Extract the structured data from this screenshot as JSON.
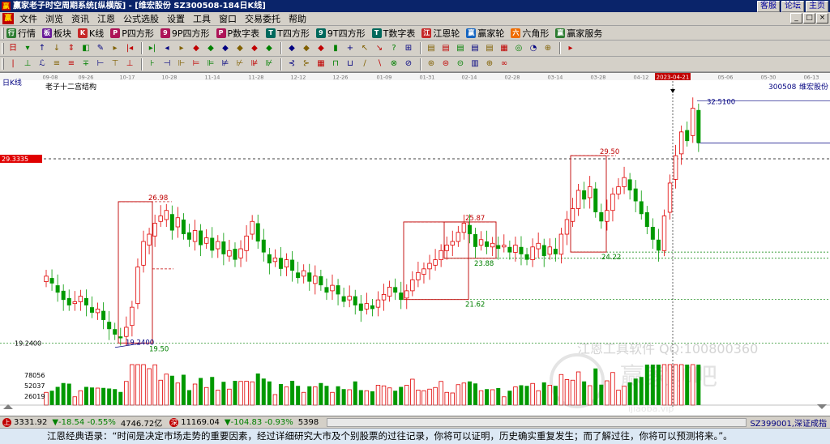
{
  "window": {
    "app_icon": "app-logo-icon",
    "title": "赢家老子时空周期系统[纵横版] - [维宏股份  SZ300508-184日K线]",
    "top_links": [
      "客服",
      "论坛",
      "主页"
    ]
  },
  "menu": {
    "logo": "app-logo-icon",
    "items": [
      "文件",
      "浏览",
      "资讯",
      "江恩",
      "公式选股",
      "设置",
      "工具",
      "窗口",
      "交易委托",
      "帮助"
    ],
    "window_controls": [
      "_",
      "□",
      "×"
    ]
  },
  "toolbar1": {
    "buttons": [
      {
        "label": "行情",
        "icon": "quote-grid-icon",
        "color": "#2e7d32"
      },
      {
        "label": "板块",
        "icon": "sector-icon",
        "color": "#6a1b9a"
      },
      {
        "label": "K线",
        "icon": "kline-icon",
        "color": "#c62828"
      },
      {
        "label": "P四方形",
        "icon": "p-square-icon",
        "color": "#ad1457"
      },
      {
        "label": "9P四方形",
        "icon": "9p-square-icon",
        "color": "#ad1457"
      },
      {
        "label": "P数字表",
        "icon": "p-number-table-icon",
        "color": "#ad1457"
      },
      {
        "label": "T四方形",
        "icon": "t-square-icon",
        "color": "#00695c"
      },
      {
        "label": "9T四方形",
        "icon": "9t-square-icon",
        "color": "#00695c"
      },
      {
        "label": "T数字表",
        "icon": "t-number-table-icon",
        "color": "#00695c"
      },
      {
        "label": "江恩轮",
        "icon": "gann-wheel-icon",
        "color": "#c62828"
      },
      {
        "label": "赢家轮",
        "icon": "winner-wheel-icon",
        "color": "#1565c0"
      },
      {
        "label": "六角形",
        "icon": "hexagon-icon",
        "color": "#ef6c00"
      },
      {
        "label": "赢家服务",
        "icon": "service-icon",
        "color": "#2e7d32"
      }
    ]
  },
  "toolbar2": {
    "icons": [
      "日",
      "▾",
      "↑",
      "↓",
      "⇕",
      "◧",
      "✎",
      "▸",
      "|◂",
      "▸|",
      "◂",
      "▸",
      "◆",
      "◆",
      "◆",
      "◆",
      "◆",
      "◆",
      "◆",
      "◆",
      "◆",
      "▮",
      "+",
      "↖",
      "↘",
      "?",
      "⊞",
      "▤",
      "▤",
      "▤",
      "▤",
      "▤",
      "▦",
      "◎",
      "◔",
      "⊕",
      "▸"
    ]
  },
  "toolbar3": {
    "icons": [
      "|",
      "⊥",
      "ℒ",
      "≡",
      "≡",
      "∓",
      "⊢",
      "⊤",
      "⊥",
      "⊦",
      "⊣",
      "⊩",
      "⊨",
      "⊫",
      "⊭",
      "⊬",
      "⊯",
      "⊮",
      "⊰",
      "⊱",
      "▦",
      "⊓",
      "⊔",
      "∕",
      "∖",
      "⊗",
      "⊘",
      "⊛",
      "⊜",
      "⊝",
      "▥",
      "⊕",
      "∞"
    ]
  },
  "chart_header": {
    "period_label": "日K线",
    "indicator_name": "老子十二宫结构",
    "stock_code": "300508",
    "stock_name": "维宏股份",
    "current_price_tag": "29.3335",
    "high_label": "32.5100",
    "date_highlight": "2023-04-21"
  },
  "chart_data": {
    "type": "candlestick",
    "title": "老子十二宫结构",
    "symbol": "300508 维宏股份",
    "x_ticks": [
      "09-08",
      "09-26",
      "10-17",
      "10-28",
      "11-14",
      "11-28",
      "12-12",
      "12-26",
      "01-09",
      "01-31",
      "02-14",
      "02-28",
      "03-14",
      "03-28",
      "04-12",
      "2023-04-21",
      "05-06",
      "05-30",
      "06-13"
    ],
    "ylim": [
      18.5,
      33.5
    ],
    "price_levels": [
      "26.98",
      "19.2400",
      "19.50",
      "25.87",
      "23.88",
      "21.62",
      "29.50",
      "24.22",
      "32.5100",
      "19.2400"
    ],
    "boxes": [
      {
        "low": 19.24,
        "high": 26.98
      },
      {
        "low": 21.62,
        "high": 25.87
      },
      {
        "low": 23.88,
        "high": 25.87
      },
      {
        "low": 24.22,
        "high": 29.5
      }
    ],
    "watermark": [
      "江恩工具软件 QQ:100800360",
      "赢家聊吧",
      "ijiaoba.vip"
    ],
    "volume_ticks": [
      "78056",
      "52037",
      "26019"
    ],
    "candles_open_close": [
      [
        22.6,
        22.9
      ],
      [
        22.8,
        22.5
      ],
      [
        22.4,
        22.0
      ],
      [
        22.1,
        21.6
      ],
      [
        21.7,
        21.3
      ],
      [
        21.4,
        21.5
      ],
      [
        21.5,
        21.8
      ],
      [
        21.7,
        21.3
      ],
      [
        21.2,
        20.9
      ],
      [
        20.9,
        21.1
      ],
      [
        21.0,
        20.5
      ],
      [
        20.4,
        20.0
      ],
      [
        20.0,
        19.7
      ],
      [
        19.6,
        19.5
      ],
      [
        19.6,
        20.1
      ],
      [
        20.2,
        21.2
      ],
      [
        21.4,
        23.4
      ],
      [
        23.5,
        24.8
      ],
      [
        24.6,
        25.2
      ],
      [
        25.1,
        25.8
      ],
      [
        25.9,
        26.2
      ],
      [
        26.0,
        26.5
      ],
      [
        26.3,
        25.4
      ],
      [
        25.6,
        26.1
      ],
      [
        26.0,
        25.2
      ],
      [
        25.3,
        24.9
      ],
      [
        24.8,
        25.4
      ],
      [
        25.4,
        24.6
      ],
      [
        24.7,
        25.0
      ],
      [
        25.0,
        24.3
      ],
      [
        24.4,
        24.8
      ],
      [
        24.8,
        24.1
      ],
      [
        24.0,
        24.3
      ],
      [
        24.4,
        23.8
      ],
      [
        23.9,
        24.4
      ],
      [
        24.3,
        25.1
      ],
      [
        25.2,
        25.9
      ],
      [
        25.8,
        24.8
      ],
      [
        24.9,
        24.2
      ],
      [
        24.1,
        23.6
      ],
      [
        23.7,
        23.9
      ],
      [
        23.9,
        23.3
      ],
      [
        23.4,
        23.8
      ],
      [
        23.8,
        23.2
      ],
      [
        23.1,
        22.8
      ],
      [
        22.9,
        23.2
      ],
      [
        23.1,
        22.6
      ],
      [
        22.5,
        22.9
      ],
      [
        22.9,
        22.4
      ],
      [
        22.3,
        22.0
      ],
      [
        22.1,
        22.4
      ],
      [
        22.4,
        21.9
      ],
      [
        21.8,
        21.5
      ],
      [
        21.6,
        21.8
      ],
      [
        21.8,
        21.3
      ],
      [
        21.4,
        21.0
      ],
      [
        21.1,
        21.4
      ],
      [
        21.3,
        21.1
      ],
      [
        21.2,
        21.6
      ],
      [
        21.6,
        21.9
      ],
      [
        21.8,
        22.3
      ],
      [
        22.3,
        22.0
      ],
      [
        22.0,
        21.6
      ],
      [
        21.7,
        22.1
      ],
      [
        22.1,
        22.7
      ],
      [
        22.7,
        23.1
      ],
      [
        23.0,
        23.3
      ],
      [
        23.3,
        23.6
      ],
      [
        23.5,
        23.8
      ],
      [
        23.8,
        24.3
      ],
      [
        24.3,
        24.6
      ],
      [
        24.6,
        24.8
      ],
      [
        24.8,
        25.3
      ],
      [
        25.3,
        25.8
      ],
      [
        25.7,
        25.2
      ],
      [
        25.2,
        24.5
      ],
      [
        24.6,
        24.9
      ],
      [
        24.8,
        24.5
      ],
      [
        24.5,
        24.7
      ],
      [
        24.6,
        24.4
      ],
      [
        24.5,
        24.6
      ],
      [
        24.5,
        24.2
      ],
      [
        24.2,
        24.6
      ],
      [
        24.5,
        24.1
      ],
      [
        24.1,
        23.8
      ],
      [
        23.8,
        24.5
      ],
      [
        24.4,
        24.7
      ],
      [
        24.6,
        24.0
      ],
      [
        24.1,
        24.5
      ],
      [
        24.4,
        24.1
      ],
      [
        24.1,
        25.2
      ],
      [
        25.2,
        26.0
      ],
      [
        25.9,
        26.6
      ],
      [
        26.6,
        27.6
      ],
      [
        27.6,
        27.1
      ],
      [
        27.2,
        27.8
      ],
      [
        27.7,
        26.4
      ],
      [
        26.4,
        25.9
      ],
      [
        25.9,
        26.5
      ],
      [
        26.5,
        27.4
      ],
      [
        27.4,
        27.8
      ],
      [
        27.8,
        28.3
      ],
      [
        28.2,
        27.6
      ],
      [
        27.7,
        27.0
      ],
      [
        27.0,
        26.3
      ],
      [
        26.4,
        25.6
      ],
      [
        25.6,
        24.9
      ],
      [
        24.9,
        24.3
      ],
      [
        24.3,
        26.2
      ],
      [
        26.4,
        28.0
      ],
      [
        28.2,
        29.5
      ],
      [
        29.6,
        30.8
      ],
      [
        30.9,
        30.3
      ],
      [
        30.6,
        32.1
      ],
      [
        32.0,
        30.2
      ]
    ]
  }
}
